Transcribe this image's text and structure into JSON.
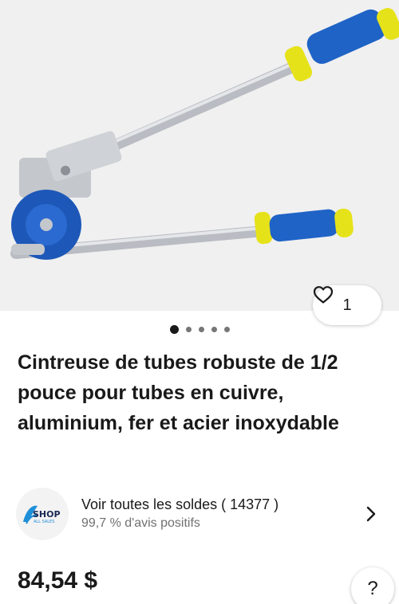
{
  "product": {
    "image_alt": "tube-bender-product-photo",
    "like_count": "1",
    "carousel": {
      "total": 5,
      "active_index": 0
    },
    "title": "Cintreuse de tubes robuste de 1/2 pouce pour tubes en cuivre, aluminium, fer et acier inoxydable",
    "price": "84,54 $"
  },
  "seller": {
    "logo_text": "SHOP",
    "logo_subtext": "ALL SALES",
    "store_link_label": "Voir toutes les soldes",
    "sales_count": "( 14377 )",
    "feedback": "99,7 % d'avis positifs"
  },
  "help": {
    "label": "?"
  },
  "icons": {
    "like": "heart-outline-icon",
    "seller_chevron": "chevron-right-icon"
  },
  "colors": {
    "grip_blue": "#1f63c6",
    "grip_yellow": "#e6e21a",
    "text": "#191919",
    "muted": "#707070"
  }
}
